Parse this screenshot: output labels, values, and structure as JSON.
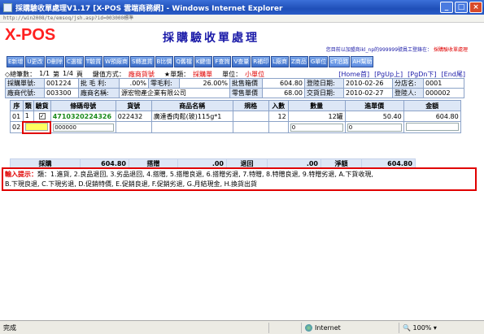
{
  "window": {
    "title": "採購驗收單處理V1.17 [X-POS 雲端商務網] - Windows Internet Explorer",
    "address": "http://win2008/te/emsoq/jsh.asp?id=003000標準",
    "minimize": "_",
    "maximize": "□",
    "close": "×"
  },
  "header": {
    "logo": "X-POS",
    "title": "採購驗收單處理",
    "login_prefix": "您目前以加盟商ikl_np的999999號員工登錄在：",
    "login_store": "採購驗收單處理"
  },
  "toolbar": [
    "E新增",
    "U更改",
    "D刪除",
    "C選檔",
    "T驗貨",
    "W預廠商",
    "S轉進貨",
    "B比價",
    "Q舊檔",
    "K鍵值",
    "F查詢",
    "V查量",
    "R補印",
    "L廠商",
    "Z商品",
    "G單位",
    "cT沿路",
    "AH幫助"
  ],
  "status": {
    "total_label": "◇總筆數：",
    "total_value": "1/1",
    "page_label": "第",
    "page_value": "1/4",
    "page_suffix": "頁",
    "key_label": "鍵值方式：",
    "key_value": "廠商貨號",
    "form_label": "★單類：",
    "form_value": "採購單",
    "unit_label": "單位：",
    "unit_value": "小單位",
    "nav_home": "[Home首]",
    "nav_pgup": "[PgUp上]",
    "nav_pgdn": "[PgDn下]",
    "nav_end": "[End尾]"
  },
  "form": {
    "r1": {
      "l1": "採購單號:",
      "v1": "001224",
      "l2": "批 毛 利:",
      "v2": ".00%",
      "l3": "零毛利:",
      "v3": "26.00%",
      "l4": "批售箱價",
      "v4": "604.80",
      "l5": "登陸日期:",
      "v5": "2010-02-26",
      "l6": "分店名:",
      "v6": "0001"
    },
    "r2": {
      "l1": "廠商代號:",
      "v1": "003300",
      "l2": "廠商名稱:",
      "v2": "源宏物產企業有限公司",
      "l4": "零售單價",
      "v4": "68.00",
      "l5": "交貨日期:",
      "v5": "2010-02-27",
      "l6": "登陸人:",
      "v6": "000002"
    }
  },
  "grid": {
    "headers": [
      "序",
      "類",
      "驗貨",
      "條碼母號",
      "貨號",
      "商品名稱",
      "規格",
      "入數",
      "數量",
      "進單價",
      "金額"
    ],
    "row1": {
      "seq": "01",
      "type": "1",
      "barcode": "4710320224326",
      "sku": "022432",
      "name": "廣達香肉鬆(玻)115g*1",
      "spec": "",
      "per": "12",
      "qty": "12罐",
      "price": "50.40",
      "amount": "604.80"
    },
    "row2": {
      "seq": "02",
      "barcode": "000000",
      "qty": "0",
      "price": "0"
    }
  },
  "totals": {
    "l1": "採購",
    "v1": "604.80",
    "l2": "搭贈",
    "v2": ".00",
    "l3": "退回",
    "v3": ".00",
    "l4": "淨額",
    "v4": "604.80"
  },
  "hint": {
    "label": "輸入提示：",
    "line1": "類：1.進貨, 2.良品退回, 3.劣品退回, 4.搭贈, 5.搭贈良退, 6.搭贈劣退, 7.特贈, 8.特贈良退, 9.特贈劣退, A.下貨收現,",
    "line2": "B.下現良退, C.下現劣退, D.促銷特價, E.促銷良退, F.促銷劣退, G.月結現金, H.換貨出貨"
  },
  "statusbar": {
    "left": "完成",
    "zone": "Internet",
    "zoom": "100%"
  }
}
